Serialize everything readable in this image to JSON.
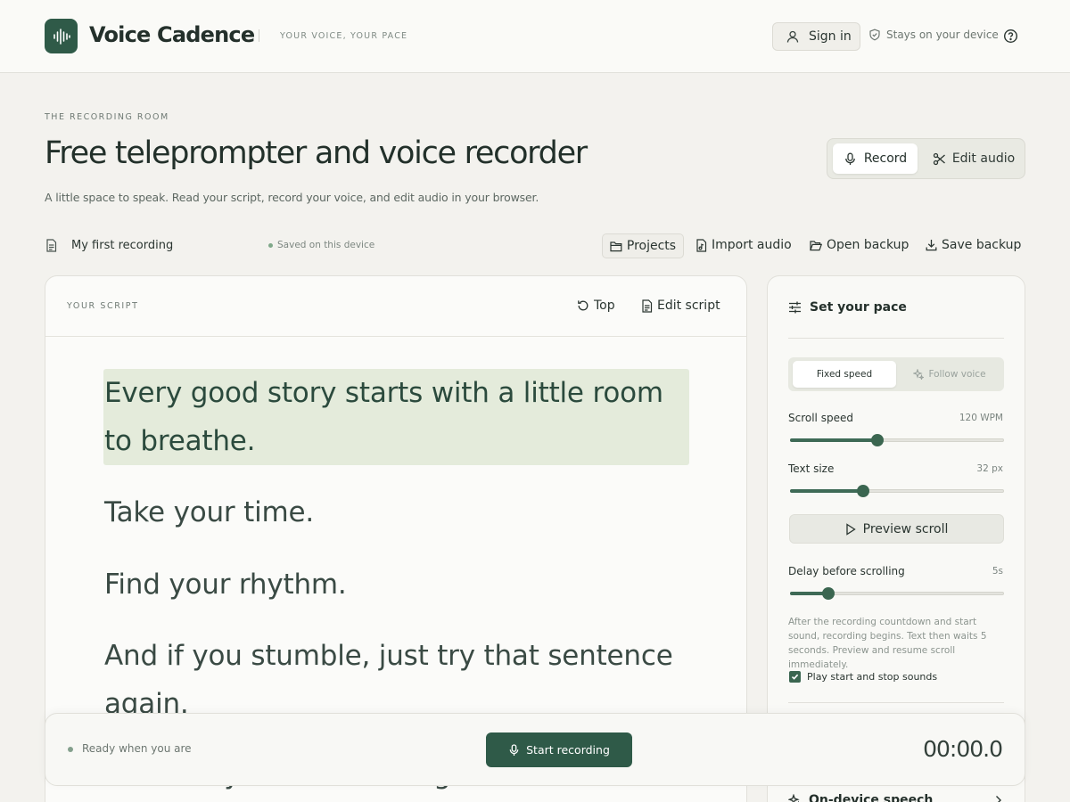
{
  "header": {
    "brand": "Voice Cadence",
    "tagline": "YOUR VOICE, YOUR PACE",
    "sign_in": "Sign in",
    "device_note": "Stays on your device",
    "icons": {
      "logo": "waveform-icon",
      "user": "user-icon",
      "shield": "shield-icon",
      "help": "help-icon"
    }
  },
  "hero": {
    "eyebrow": "THE RECORDING ROOM",
    "title": "Free teleprompter and voice recorder",
    "subtitle": "A little space to speak. Read your script, record your voice, and edit audio in your browser.",
    "modes": {
      "record": "Record",
      "edit_audio": "Edit audio",
      "active": "Record"
    }
  },
  "project": {
    "name": "My first recording",
    "status": "Saved on this device",
    "actions": {
      "projects": "Projects",
      "import_audio": "Import audio",
      "open_backup": "Open backup",
      "save_backup": "Save backup"
    }
  },
  "script": {
    "label": "YOUR SCRIPT",
    "top_button": "Top",
    "edit_button": "Edit script",
    "lines": [
      "Every good story starts with a little room to breathe.",
      "Take your time.",
      "Find your rhythm.",
      "And if you stumble, just try that sentence again.",
      "Your story is worth telling."
    ],
    "highlighted_line": 0
  },
  "pace": {
    "title": "Set your pace",
    "modes": {
      "fixed": "Fixed speed",
      "follow": "Follow voice",
      "active": "Fixed speed"
    },
    "scroll_speed": {
      "label": "Scroll speed",
      "value_text": "120 WPM",
      "level": 0.41
    },
    "text_size": {
      "label": "Text size",
      "value_text": "32 px",
      "level": 0.34
    },
    "preview_button": "Preview scroll",
    "delay": {
      "label": "Delay before scrolling",
      "value_text": "5s",
      "level": 0.18
    },
    "delay_note": "After the recording countdown and start sound, recording begins. Text then waits 5 seconds. Preview and resume scroll immediately.",
    "play_sounds": {
      "label": "Play start and stop sounds",
      "checked": true
    },
    "on_device": "On-device speech"
  },
  "recorder": {
    "status": "Ready when you are",
    "start_button": "Start recording",
    "timer": "00:00.0"
  },
  "colors": {
    "accent": "#2f5a48",
    "highlight": "#e4ebdb",
    "background": "#f3f2ee"
  }
}
